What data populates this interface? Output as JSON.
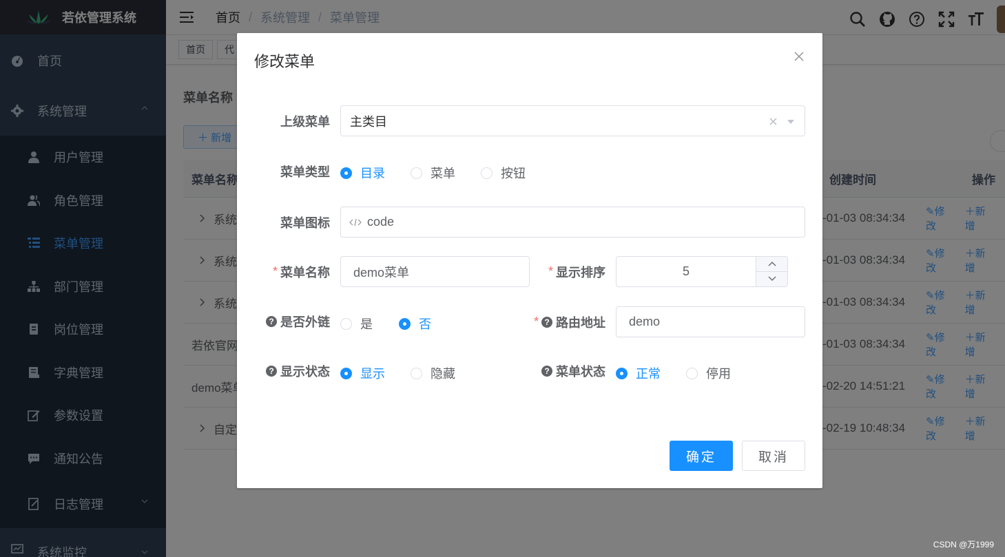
{
  "sidebar": {
    "title": "若依管理系统",
    "items": [
      {
        "label": "首页",
        "icon": "dashboard-icon"
      },
      {
        "label": "系统管理",
        "icon": "gear-icon"
      }
    ],
    "submenu": [
      {
        "label": "用户管理",
        "icon": "user-icon"
      },
      {
        "label": "角色管理",
        "icon": "peoples-icon"
      },
      {
        "label": "菜单管理",
        "icon": "tree-table-icon"
      },
      {
        "label": "部门管理",
        "icon": "tree-icon"
      },
      {
        "label": "岗位管理",
        "icon": "post-icon"
      },
      {
        "label": "字典管理",
        "icon": "dict-icon"
      },
      {
        "label": "参数设置",
        "icon": "edit-icon"
      },
      {
        "label": "通知公告",
        "icon": "message-icon"
      },
      {
        "label": "日志管理",
        "icon": "log-icon"
      }
    ],
    "bottom_item": {
      "label": "系统监控",
      "icon": "monitor-icon"
    }
  },
  "navbar": {
    "breadcrumb": [
      "首页",
      "系统管理",
      "菜单管理"
    ],
    "separator": "/"
  },
  "tags": [
    "首页",
    "代"
  ],
  "page": {
    "search_label": "菜单名称",
    "add_button": "＋ 新增"
  },
  "table": {
    "headers": {
      "name": "菜单名称",
      "time": "创建时间",
      "ops": "操作"
    },
    "rows": [
      {
        "name": "系统",
        "time": "-01-03 08:34:34",
        "expandable": true
      },
      {
        "name": "系统",
        "time": "-01-03 08:34:34",
        "expandable": true
      },
      {
        "name": "系统",
        "time": "-01-03 08:34:34",
        "expandable": true
      },
      {
        "name": "若依官网",
        "time": "-01-03 08:34:34",
        "expandable": false
      },
      {
        "name": "demo菜单",
        "time": "-02-20 14:51:21",
        "expandable": false
      },
      {
        "name": "自定",
        "time": "-02-19 10:48:34",
        "expandable": true
      }
    ],
    "edit_label": "修改",
    "add_label": "新增"
  },
  "dialog": {
    "title": "修改菜单",
    "parent_label": "上级菜单",
    "parent_value": "主类目",
    "type_label": "菜单类型",
    "type_options": [
      "目录",
      "菜单",
      "按钮"
    ],
    "type_selected": "目录",
    "icon_label": "菜单图标",
    "icon_value": "code",
    "name_label": "菜单名称",
    "name_value": "demo菜单",
    "order_label": "显示排序",
    "order_value": "5",
    "external_label": "是否外链",
    "external_options": [
      "是",
      "否"
    ],
    "external_selected": "否",
    "path_label": "路由地址",
    "path_value": "demo",
    "visible_label": "显示状态",
    "visible_options": [
      "显示",
      "隐藏"
    ],
    "visible_selected": "显示",
    "status_label": "菜单状态",
    "status_options": [
      "正常",
      "停用"
    ],
    "status_selected": "正常",
    "confirm": "确定",
    "cancel": "取消",
    "required_mark": "*",
    "help_mark": "?"
  },
  "colors": {
    "primary": "#1890ff",
    "sidebar_bg": "#304156",
    "required": "#f56c6c"
  },
  "watermark": "CSDN @万1999"
}
